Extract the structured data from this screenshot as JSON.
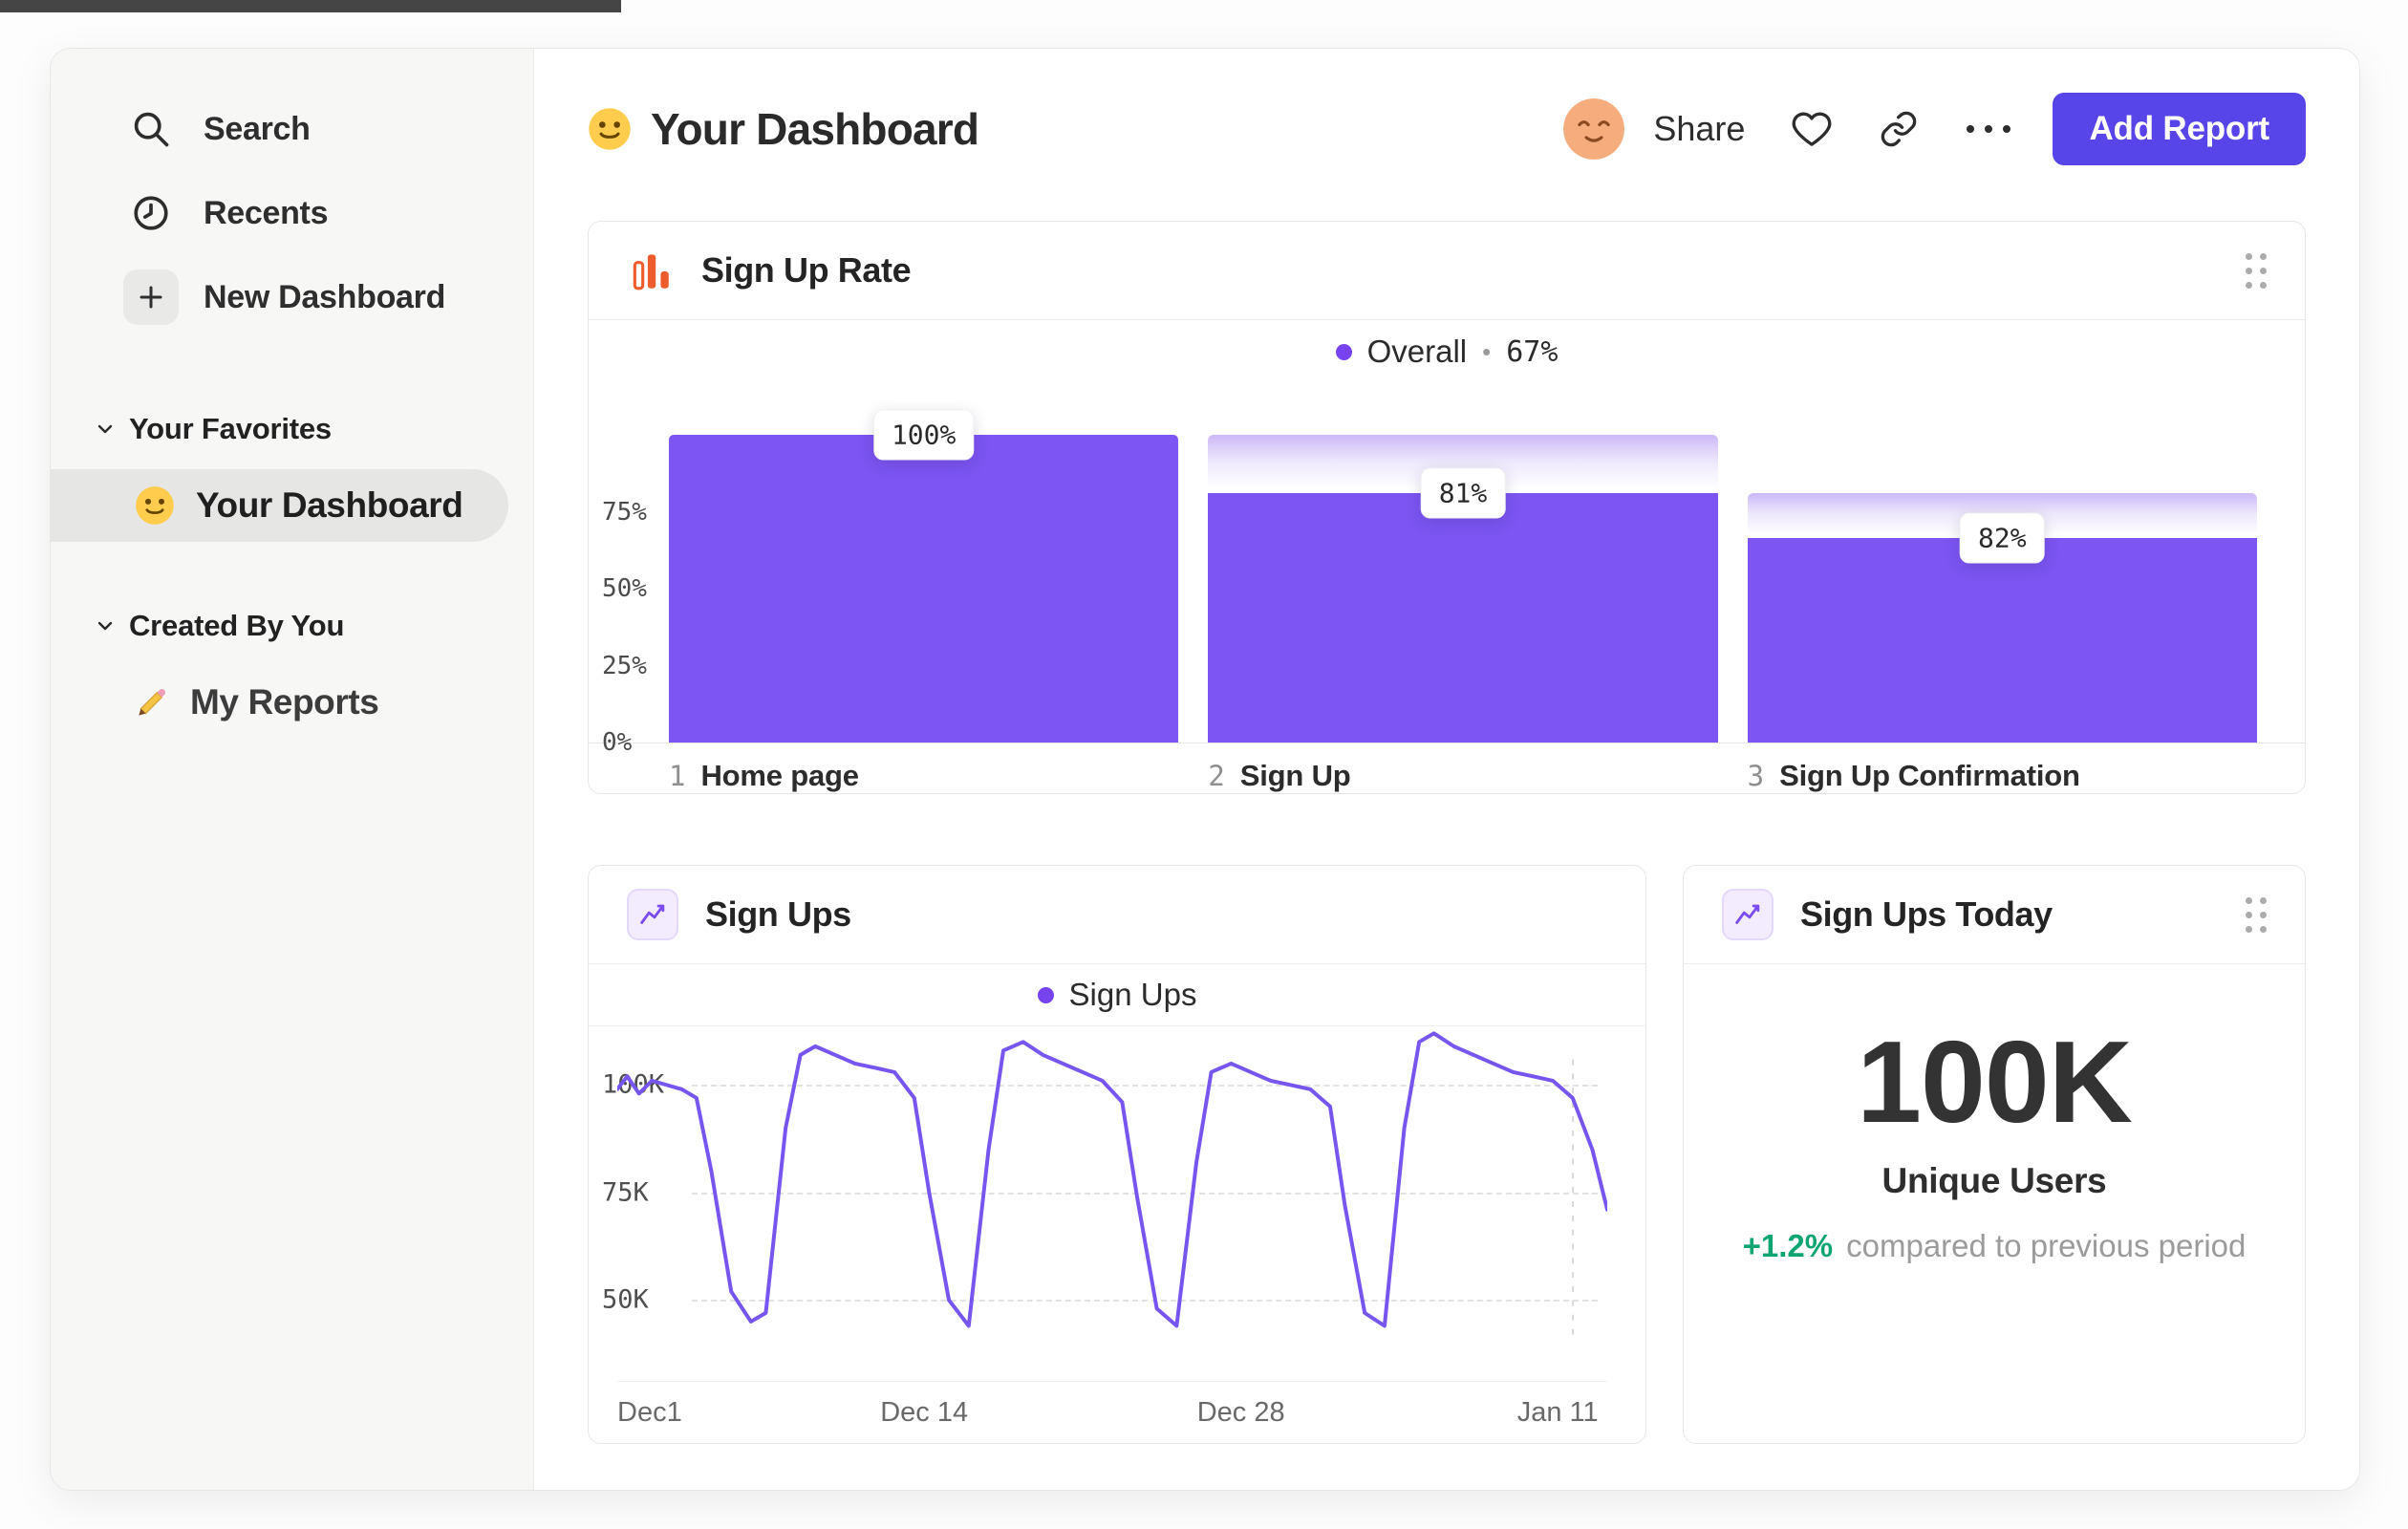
{
  "sidebar": {
    "items": [
      {
        "label": "Search"
      },
      {
        "label": "Recents"
      },
      {
        "label": "New Dashboard"
      }
    ],
    "sections": [
      {
        "title": "Your Favorites",
        "items": [
          {
            "label": "Your Dashboard",
            "selected": true
          }
        ]
      },
      {
        "title": "Created By You",
        "items": [
          {
            "label": "My Reports"
          }
        ]
      }
    ]
  },
  "header": {
    "title": "Your Dashboard",
    "share_label": "Share",
    "add_report_label": "Add Report"
  },
  "colors": {
    "accent_purple": "#7C55F2",
    "legend_purple": "#7743F0",
    "button_purple": "#5745EA",
    "icon_orange": "#EE5B2C",
    "delta_green": "#0FA573",
    "gradient_top": "#CBB8F7"
  },
  "chart_data": [
    {
      "type": "bar",
      "subtype": "funnel",
      "title": "Sign Up Rate",
      "legend": {
        "name": "Overall",
        "separator": "•",
        "value_label": "67%"
      },
      "categories": [
        "Home page",
        "Sign Up",
        "Sign Up Confirmation"
      ],
      "step_indices": [
        "1",
        "2",
        "3"
      ],
      "step_conversion_labels": [
        "100%",
        "81%",
        "82%"
      ],
      "step_conversion_pct": [
        100,
        81,
        82
      ],
      "overall_height_pct": [
        100,
        81,
        66.4
      ],
      "y_ticks": [
        "75%",
        "50%",
        "25%",
        "0%"
      ],
      "ylim": [
        0,
        100
      ],
      "legend_position": "top-center"
    },
    {
      "type": "line",
      "title": "Sign Ups",
      "series": [
        {
          "name": "Sign Ups",
          "points": [
            [
              0.0,
              99
            ],
            [
              0.01,
              102
            ],
            [
              0.022,
              98
            ],
            [
              0.035,
              101
            ],
            [
              0.05,
              100
            ],
            [
              0.065,
              99
            ],
            [
              0.08,
              97
            ],
            [
              0.095,
              80
            ],
            [
              0.115,
              52
            ],
            [
              0.135,
              45
            ],
            [
              0.15,
              47
            ],
            [
              0.17,
              90
            ],
            [
              0.185,
              107
            ],
            [
              0.2,
              109
            ],
            [
              0.22,
              107
            ],
            [
              0.24,
              105
            ],
            [
              0.26,
              104
            ],
            [
              0.28,
              103
            ],
            [
              0.3,
              97
            ],
            [
              0.315,
              75
            ],
            [
              0.335,
              50
            ],
            [
              0.355,
              44
            ],
            [
              0.375,
              85
            ],
            [
              0.39,
              108
            ],
            [
              0.41,
              110
            ],
            [
              0.43,
              107
            ],
            [
              0.45,
              105
            ],
            [
              0.47,
              103
            ],
            [
              0.49,
              101
            ],
            [
              0.51,
              96
            ],
            [
              0.525,
              74
            ],
            [
              0.545,
              48
            ],
            [
              0.565,
              44
            ],
            [
              0.585,
              82
            ],
            [
              0.6,
              103
            ],
            [
              0.62,
              105
            ],
            [
              0.64,
              103
            ],
            [
              0.66,
              101
            ],
            [
              0.68,
              100
            ],
            [
              0.7,
              99
            ],
            [
              0.72,
              95
            ],
            [
              0.735,
              72
            ],
            [
              0.755,
              47
            ],
            [
              0.775,
              44
            ],
            [
              0.795,
              90
            ],
            [
              0.81,
              110
            ],
            [
              0.825,
              112
            ],
            [
              0.845,
              109
            ],
            [
              0.865,
              107
            ],
            [
              0.885,
              105
            ],
            [
              0.905,
              103
            ],
            [
              0.925,
              102
            ],
            [
              0.945,
              101
            ],
            [
              0.965,
              97
            ],
            [
              0.985,
              85
            ],
            [
              1.0,
              71
            ]
          ]
        }
      ],
      "y_tick_labels": [
        "100K",
        "75K",
        "50K"
      ],
      "y_ticks_k": [
        100,
        75,
        50
      ],
      "x_ticks": [
        {
          "label": "Dec1",
          "pos": 0
        },
        {
          "label": "Dec 14",
          "pos": 0.31
        },
        {
          "label": "Dec 28",
          "pos": 0.63
        },
        {
          "label": "Jan 11",
          "pos": 0.95
        }
      ],
      "unit": "sign ups (thousands)",
      "grid": "dashed-horizontal",
      "legend_position": "top-center"
    },
    {
      "type": "metric",
      "title": "Sign Ups Today",
      "value": "100K",
      "label": "Unique Users",
      "delta": "+1.2%",
      "comparison": "compared to previous period"
    }
  ]
}
